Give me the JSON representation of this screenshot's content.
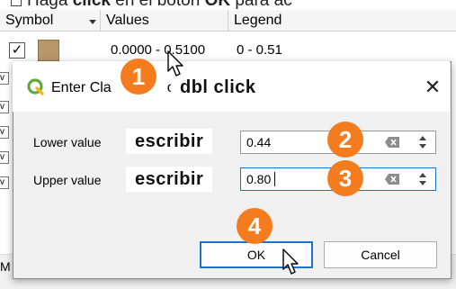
{
  "instruction": {
    "bullet_text": "Haga",
    "action": "click",
    "middle": "en el botón",
    "target": "OK",
    "tail": "para ac"
  },
  "table": {
    "headers": [
      "Symbol",
      "Values",
      "Legend"
    ],
    "row": {
      "checked": "✓",
      "swatch_color": "#b89869",
      "values": "0.0000 - 0.5100",
      "legend": "0 - 0.51"
    },
    "side_marks": [
      "v",
      "v",
      "v",
      "v",
      "v"
    ]
  },
  "footer_label": "M",
  "dialog": {
    "title_visible": "Enter Cla",
    "title_tail": "ou",
    "hint_title": "dbl click",
    "close_icon": "✕",
    "lower": {
      "label": "Lower value",
      "hint": "escribir",
      "value": "0.44"
    },
    "upper": {
      "label": "Upper value",
      "hint": "escribir",
      "value": "0.80"
    },
    "ok_label": "OK",
    "cancel_label": "Cancel"
  },
  "badges": [
    "1",
    "2",
    "3",
    "4"
  ],
  "colors": {
    "badge": "#f47c1f",
    "focus": "#1d74c9",
    "logo_green": "#63a83f"
  }
}
